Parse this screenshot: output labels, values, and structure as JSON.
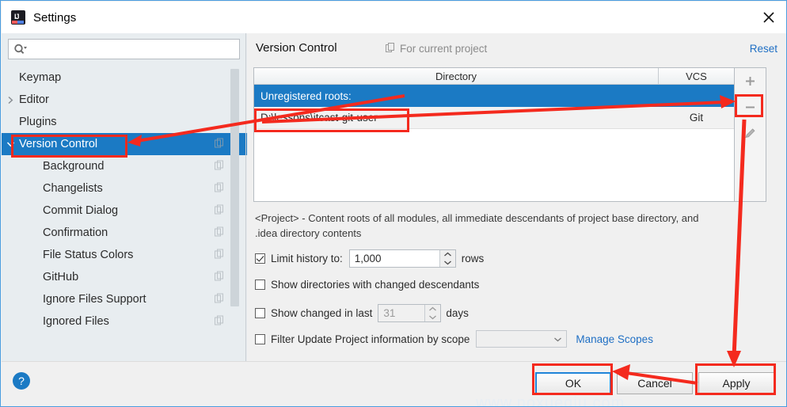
{
  "window": {
    "title": "Settings",
    "app_icon": "intellij-idea-icon",
    "close_label": "✕"
  },
  "search": {
    "value": "",
    "placeholder": "",
    "icon": "search-icon"
  },
  "sidebar": {
    "items": [
      {
        "label": "Keymap",
        "level": 1,
        "expander": "",
        "selected": false,
        "copy_icon": false
      },
      {
        "label": "Editor",
        "level": 0,
        "expander": "right",
        "selected": false,
        "copy_icon": false
      },
      {
        "label": "Plugins",
        "level": 1,
        "expander": "",
        "selected": false,
        "copy_icon": false
      },
      {
        "label": "Version Control",
        "level": 0,
        "expander": "down",
        "selected": true,
        "copy_icon": true
      },
      {
        "label": "Background",
        "level": 2,
        "expander": "",
        "selected": false,
        "copy_icon": true
      },
      {
        "label": "Changelists",
        "level": 2,
        "expander": "",
        "selected": false,
        "copy_icon": true
      },
      {
        "label": "Commit Dialog",
        "level": 2,
        "expander": "",
        "selected": false,
        "copy_icon": true
      },
      {
        "label": "Confirmation",
        "level": 2,
        "expander": "",
        "selected": false,
        "copy_icon": true
      },
      {
        "label": "File Status Colors",
        "level": 2,
        "expander": "",
        "selected": false,
        "copy_icon": true
      },
      {
        "label": "GitHub",
        "level": 2,
        "expander": "",
        "selected": false,
        "copy_icon": true
      },
      {
        "label": "Ignore Files Support",
        "level": 2,
        "expander": "",
        "selected": false,
        "copy_icon": true
      },
      {
        "label": "Ignored Files",
        "level": 2,
        "expander": "",
        "selected": false,
        "copy_icon": true
      }
    ]
  },
  "panel": {
    "title": "Version Control",
    "scope_label": "For current project",
    "scope_icon": "copy-icon",
    "reset_label": "Reset"
  },
  "table": {
    "columns": [
      "Directory",
      "VCS"
    ],
    "rows": [
      {
        "type": "group",
        "directory": "Unregistered roots:",
        "vcs": ""
      },
      {
        "type": "item",
        "directory": "D:\\lessons\\itcast-git-user",
        "vcs": "Git"
      }
    ]
  },
  "toolbar": {
    "add_label": "+",
    "remove_label": "–",
    "edit_label": "edit-pencil-icon"
  },
  "description": {
    "line1": "<Project> - Content roots of all modules, all immediate descendants of project base directory, and",
    "line2": ".idea directory contents"
  },
  "options": {
    "limit_history": {
      "label": "Limit history to:",
      "checked": true,
      "value": "1,000",
      "suffix": "rows"
    },
    "show_directories": {
      "label": "Show directories with changed descendants",
      "checked": false
    },
    "show_changed_in_last": {
      "label": "Show changed in last",
      "checked": false,
      "value": "31",
      "suffix": "days"
    },
    "filter_update": {
      "label": "Filter Update Project information by scope",
      "checked": false,
      "scope_value": "",
      "manage_link": "Manage Scopes"
    }
  },
  "footer": {
    "help_label": "?",
    "ok_label": "OK",
    "cancel_label": "Cancel",
    "apply_label": "Apply"
  },
  "watermark": {
    "text": "www.noxueqiu.com"
  },
  "colors": {
    "accent_blue": "#1b7ac4",
    "annotation_red": "#f42a1e",
    "link_blue": "#1f6fc4",
    "focus_blue": "#1f84d8"
  }
}
